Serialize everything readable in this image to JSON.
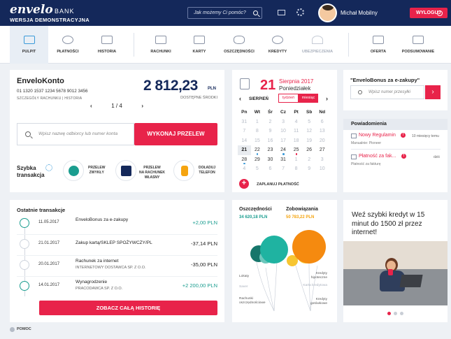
{
  "header": {
    "logo_main": "envelo",
    "logo_bank": "BANK",
    "logo_sub": "WERSJA DEMONSTRACYJNA",
    "search_placeholder": "Jak możemy Ci pomóc?",
    "user_name": "Michał Mobilny",
    "logout_label": "WYLOGUJ"
  },
  "nav": [
    {
      "label": "PULPIT",
      "icon": "desktop-icon",
      "active": true
    },
    {
      "label": "PŁATNOŚCI",
      "icon": "payments-icon"
    },
    {
      "label": "HISTORIA",
      "icon": "history-icon"
    },
    {
      "label": "RACHUNKI",
      "icon": "wallet-icon"
    },
    {
      "label": "KARTY",
      "icon": "card-icon"
    },
    {
      "label": "OSZCZĘDNOŚCI",
      "icon": "savings-icon"
    },
    {
      "label": "KREDYTY",
      "icon": "loan-icon"
    },
    {
      "label": "UBEZPIECZENIA",
      "icon": "umbrella-icon",
      "disabled": true
    },
    {
      "label": "OFERTA",
      "icon": "cart-icon"
    },
    {
      "label": "PODSUMOWANIE",
      "icon": "summary-icon"
    }
  ],
  "account": {
    "name": "EnveloKonto",
    "number": "01 1320 1537 1234 5678 9012 3456",
    "link_details": "SZCZEGÓŁY RACHUNKU",
    "link_history": "HISTORIA",
    "balance": "2 812,23",
    "currency": "PLN",
    "balance_label": "DOSTĘPNE ŚRODKI",
    "pager": "1 / 4"
  },
  "transfer": {
    "placeholder": "Wpisz nazwę odbiorcy lub numer konta",
    "button": "WYKONAJ PRZELEW"
  },
  "quick": {
    "label_line1": "Szybka",
    "label_line2": "transakcja",
    "items": [
      {
        "l1": "PRZELEW",
        "l2": "ZWYKŁY",
        "l3": ""
      },
      {
        "l1": "PRZELEW",
        "l2": "NA RACHUNEK",
        "l3": "WŁASNY"
      },
      {
        "l1": "DOŁADUJ",
        "l2": "TELEFON",
        "l3": ""
      }
    ]
  },
  "calendar": {
    "day": "21",
    "month_year": "Sierpnia 2017",
    "weekday": "Poniedziałek",
    "month_label": "SIERPIEŃ",
    "toggle_week": "tydzień",
    "toggle_month": "miesiąc",
    "weekdays": [
      "Pn",
      "Wt",
      "Śr",
      "Cz",
      "Pt",
      "Sb",
      "Nd"
    ],
    "weeks": [
      [
        "31",
        "1",
        "2",
        "3",
        "4",
        "5",
        "6"
      ],
      [
        "7",
        "8",
        "9",
        "10",
        "11",
        "12",
        "13"
      ],
      [
        "14",
        "15",
        "16",
        "17",
        "18",
        "19",
        "20"
      ],
      [
        "21",
        "22",
        "23",
        "24",
        "25",
        "26",
        "27"
      ],
      [
        "28",
        "29",
        "30",
        "31",
        "1",
        "2",
        "3"
      ],
      [
        "4",
        "5",
        "6",
        "7",
        "8",
        "9",
        "10"
      ]
    ],
    "add_label": "ZAPLANUJ PŁATNOŚĆ"
  },
  "bonus": {
    "title": "\"EnveloBonus za e-zakupy\"",
    "placeholder": "Wpisz numer przesyłki"
  },
  "notifications": {
    "header": "Powiadomienia",
    "items": [
      {
        "title": "Nowy Regulamin",
        "time": "10 miesięcy temu",
        "sub": "Manualnie: Pioneer"
      },
      {
        "title": "Płatność za fak...",
        "time": "dziś",
        "sub": "Płatność za fakturę"
      }
    ]
  },
  "transactions": {
    "title": "Ostatnie transakcje",
    "items": [
      {
        "date": "11.05.2017",
        "name": "EnveloBonus za e-zakupy",
        "sub": "",
        "amount": "+2,00 PLN",
        "positive": true
      },
      {
        "date": "21.01.2017",
        "name": "Zakup kartą/SKLEP SPOŻYWCZY/PL",
        "sub": "",
        "amount": "-37,14 PLN",
        "positive": false
      },
      {
        "date": "20.01.2017",
        "name": "Rachunek za internet",
        "sub": "INTERNETOWY DOSTAWCA SP. Z O.O.",
        "amount": "-35,00 PLN",
        "positive": false
      },
      {
        "date": "14.01.2017",
        "name": "Wynagrodzenie",
        "sub": "PRACODAWCA SP. Z O.O.",
        "amount": "+2 200,00 PLN",
        "positive": true
      }
    ],
    "button": "ZOBACZ CAŁĄ HISTORIĘ"
  },
  "chart_data": {
    "type": "bubble",
    "groups": [
      {
        "name": "Oszczędności",
        "total": "34 620,18 PLN",
        "color": "#1a9d8f",
        "items": [
          "Lokaty",
          "Saver",
          "Rachunki oszczędnościowe"
        ]
      },
      {
        "name": "Zobowiązania",
        "total": "50 783,22 PLN",
        "color": "#f5a40f",
        "items": [
          "Kredyty hipoteczne",
          "Karta kredytowa",
          "Kredyty gotówkowe"
        ]
      }
    ]
  },
  "promo": {
    "text": "Weź szybki kredyt w 15 minut do 1500 zł przez internet!"
  },
  "footer": {
    "help": "POMOC"
  }
}
